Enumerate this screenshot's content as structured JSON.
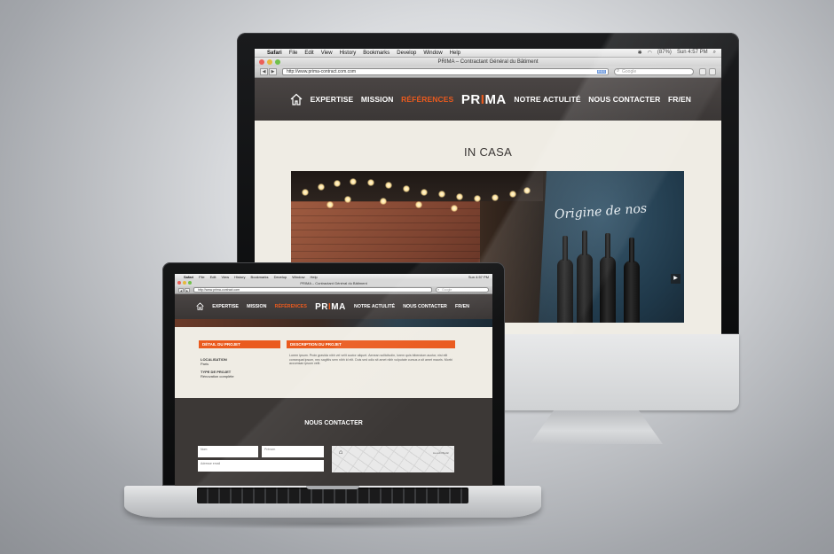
{
  "colors": {
    "accent": "#ea5a1e",
    "nav_bg": "#423d3c",
    "page_bg": "#efece4"
  },
  "os": {
    "menu": [
      "Safari",
      "File",
      "Edit",
      "View",
      "History",
      "Bookmarks",
      "Develop",
      "Window",
      "Help"
    ],
    "clock": "Sun 4:57 PM",
    "battery": "(87%)"
  },
  "browser": {
    "window_title": "PRIMA – Contractant Général du Bâtiment",
    "url": "http://www.prima-contract.com.com",
    "url_mb": "http://www.prima-contract.com",
    "rss": "RSS",
    "search_placeholder": "Google"
  },
  "site": {
    "logo_left": "PR",
    "logo_i": "I",
    "logo_right": "MA",
    "nav": {
      "expertise": "EXPERTISE",
      "mission": "MISSION",
      "references": "RÉFÉRENCES",
      "actualite": "NOTRE ACTULITÉ",
      "contact": "NOUS CONTACTER",
      "lang": "FR/EN"
    },
    "page_title": "IN CASA",
    "chalk_text": "Origine de nos",
    "hero_arrow": "▶"
  },
  "laptop": {
    "detail_heading": "DÉTAIL DU PROJET",
    "description_heading": "DESCRIPTION DU PROJET",
    "localisation_label": "LOCALISATION",
    "localisation_value": "Paris",
    "type_label": "TYPE DE PROJET",
    "type_value": "Rénovation complète",
    "description_text": "Lorem ipsum. Proin gravida nibh vel velit auctor aliquet. Aenean sollicitudin, lorem quis bibendum auctor, nisi elit consequat ipsum, nec sagittis sem nibh id elit. Duis sed odio sit amet nibh vulputate cursus a sit amet mauris. Morbi accumsan ipsum velit.",
    "contact_title": "NOUS CONTACTER",
    "field_name": "Nom",
    "field_firstname": "Prénom",
    "field_email": "Adresse email",
    "map_label": "Lieu-dit Bodic"
  }
}
